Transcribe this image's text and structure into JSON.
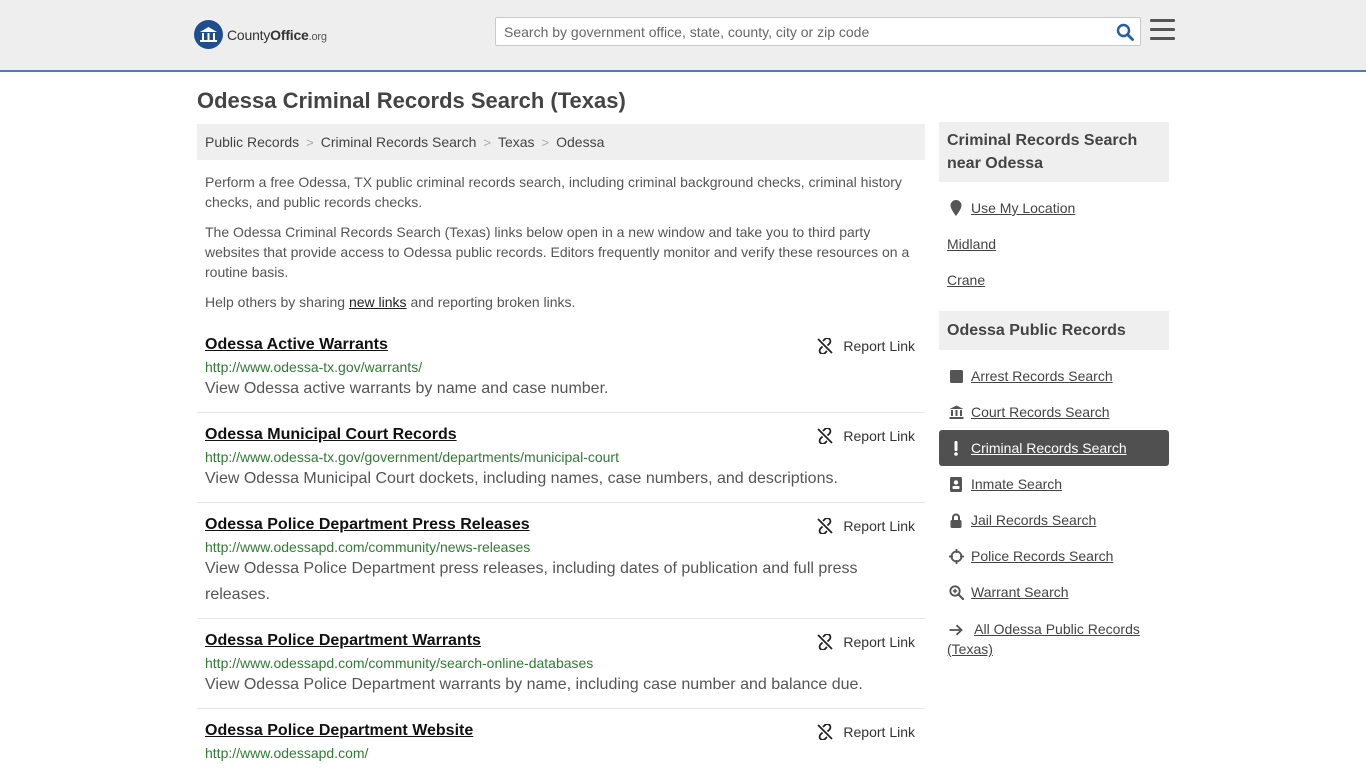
{
  "header": {
    "logo_main": "County",
    "logo_bold": "Office",
    "logo_tld": ".org",
    "search_placeholder": "Search by government office, state, county, city or zip code"
  },
  "page_title": "Odessa Criminal Records Search (Texas)",
  "breadcrumb": [
    "Public Records",
    "Criminal Records Search",
    "Texas",
    "Odessa"
  ],
  "intro": {
    "p1": "Perform a free Odessa, TX public criminal records search, including criminal background checks, criminal history checks, and public records checks.",
    "p2": "The Odessa Criminal Records Search (Texas) links below open in a new window and take you to third party websites that provide access to Odessa public records. Editors frequently monitor and verify these resources on a routine basis.",
    "p3_before": "Help others by sharing ",
    "p3_link": "new links",
    "p3_after": " and reporting broken links."
  },
  "report_label": "Report Link",
  "records": [
    {
      "title": "Odessa Active Warrants",
      "url": "http://www.odessa-tx.gov/warrants/",
      "desc": "View Odessa active warrants by name and case number."
    },
    {
      "title": "Odessa Municipal Court Records",
      "url": "http://www.odessa-tx.gov/government/departments/municipal-court",
      "desc": "View Odessa Municipal Court dockets, including names, case numbers, and descriptions."
    },
    {
      "title": "Odessa Police Department Press Releases",
      "url": "http://www.odessapd.com/community/news-releases",
      "desc": "View Odessa Police Department press releases, including dates of publication and full press releases."
    },
    {
      "title": "Odessa Police Department Warrants",
      "url": "http://www.odessapd.com/community/search-online-databases",
      "desc": "View Odessa Police Department warrants by name, including case number and balance due."
    },
    {
      "title": "Odessa Police Department Website",
      "url": "http://www.odessapd.com/",
      "desc": ""
    }
  ],
  "sidebar": {
    "nearby_heading": "Criminal Records Search near Odessa",
    "nearby": [
      {
        "label": "Use My Location",
        "icon": "location-pin-icon"
      },
      {
        "label": "Midland"
      },
      {
        "label": "Crane"
      }
    ],
    "public_heading": "Odessa Public Records",
    "public": [
      {
        "label": "Arrest Records Search",
        "icon": "square-icon"
      },
      {
        "label": "Court Records Search",
        "icon": "courthouse-icon"
      },
      {
        "label": "Criminal Records Search",
        "icon": "exclamation-icon",
        "active": true
      },
      {
        "label": "Inmate Search",
        "icon": "id-badge-icon"
      },
      {
        "label": "Jail Records Search",
        "icon": "lock-icon"
      },
      {
        "label": "Police Records Search",
        "icon": "crosshair-icon"
      },
      {
        "label": "Warrant Search",
        "icon": "magnifier-plus-icon"
      }
    ],
    "all_link": "All Odessa Public Records (Texas)"
  },
  "colors": {
    "accent": "#4a7bbd",
    "url_green": "#2e7d32",
    "active_bg": "#505050"
  }
}
